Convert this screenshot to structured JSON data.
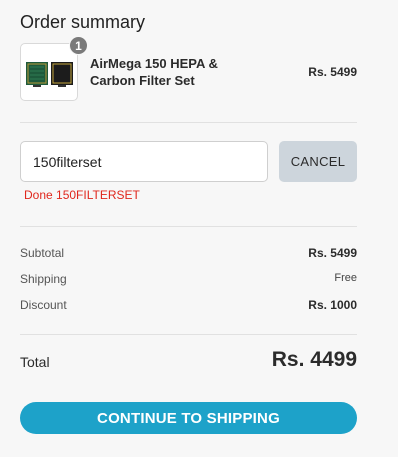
{
  "header": {
    "title": "Order summary"
  },
  "item": {
    "quantity": "1",
    "name": "AirMega 150 HEPA & Carbon Filter Set",
    "price": "Rs. 5499"
  },
  "coupon": {
    "value": "150filterset",
    "cancel_label": "CANCEL",
    "status": "Done 150FILTERSET"
  },
  "lines": {
    "subtotal_label": "Subtotal",
    "subtotal_value": "Rs. 5499",
    "shipping_label": "Shipping",
    "shipping_value": "Free",
    "discount_label": "Discount",
    "discount_value": "Rs. 1000"
  },
  "total": {
    "label": "Total",
    "value": "Rs. 4499"
  },
  "actions": {
    "continue_label": "CONTINUE TO SHIPPING"
  },
  "colors": {
    "accent": "#1da2c9",
    "status_error": "#e0271d",
    "cancel_bg": "#cdd5dc"
  }
}
